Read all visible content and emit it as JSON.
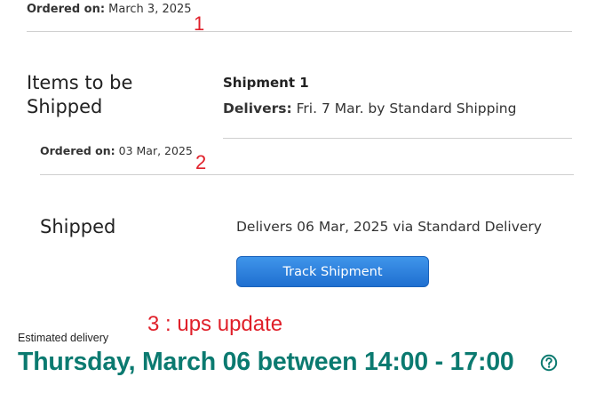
{
  "order1": {
    "label": "Ordered on:",
    "date": "March 3, 2025"
  },
  "annotations": {
    "marker1": "1",
    "marker2": "2",
    "marker3": "3 : ups update"
  },
  "items_section": {
    "heading_line1": "Items to be",
    "heading_line2": "Shipped",
    "shipment_label": "Shipment 1",
    "delivers_label": "Delivers:",
    "delivers_text": "Fri. 7 Mar. by Standard Shipping"
  },
  "order2": {
    "label": "Ordered on:",
    "date": "03 Mar, 2025"
  },
  "shipped_section": {
    "heading": "Shipped",
    "delivery_text": "Delivers 06 Mar, 2025 via Standard Delivery",
    "track_button_label": "Track Shipment"
  },
  "ups": {
    "estimated_label": "Estimated delivery",
    "estimated_value": "Thursday, March 06 between 14:00 - 17:00",
    "help_icon": "question-circle-icon"
  },
  "colors": {
    "accent_teal": "#0b7a70",
    "button_blue": "#2a80dd",
    "annotation_red": "#e0202a"
  }
}
